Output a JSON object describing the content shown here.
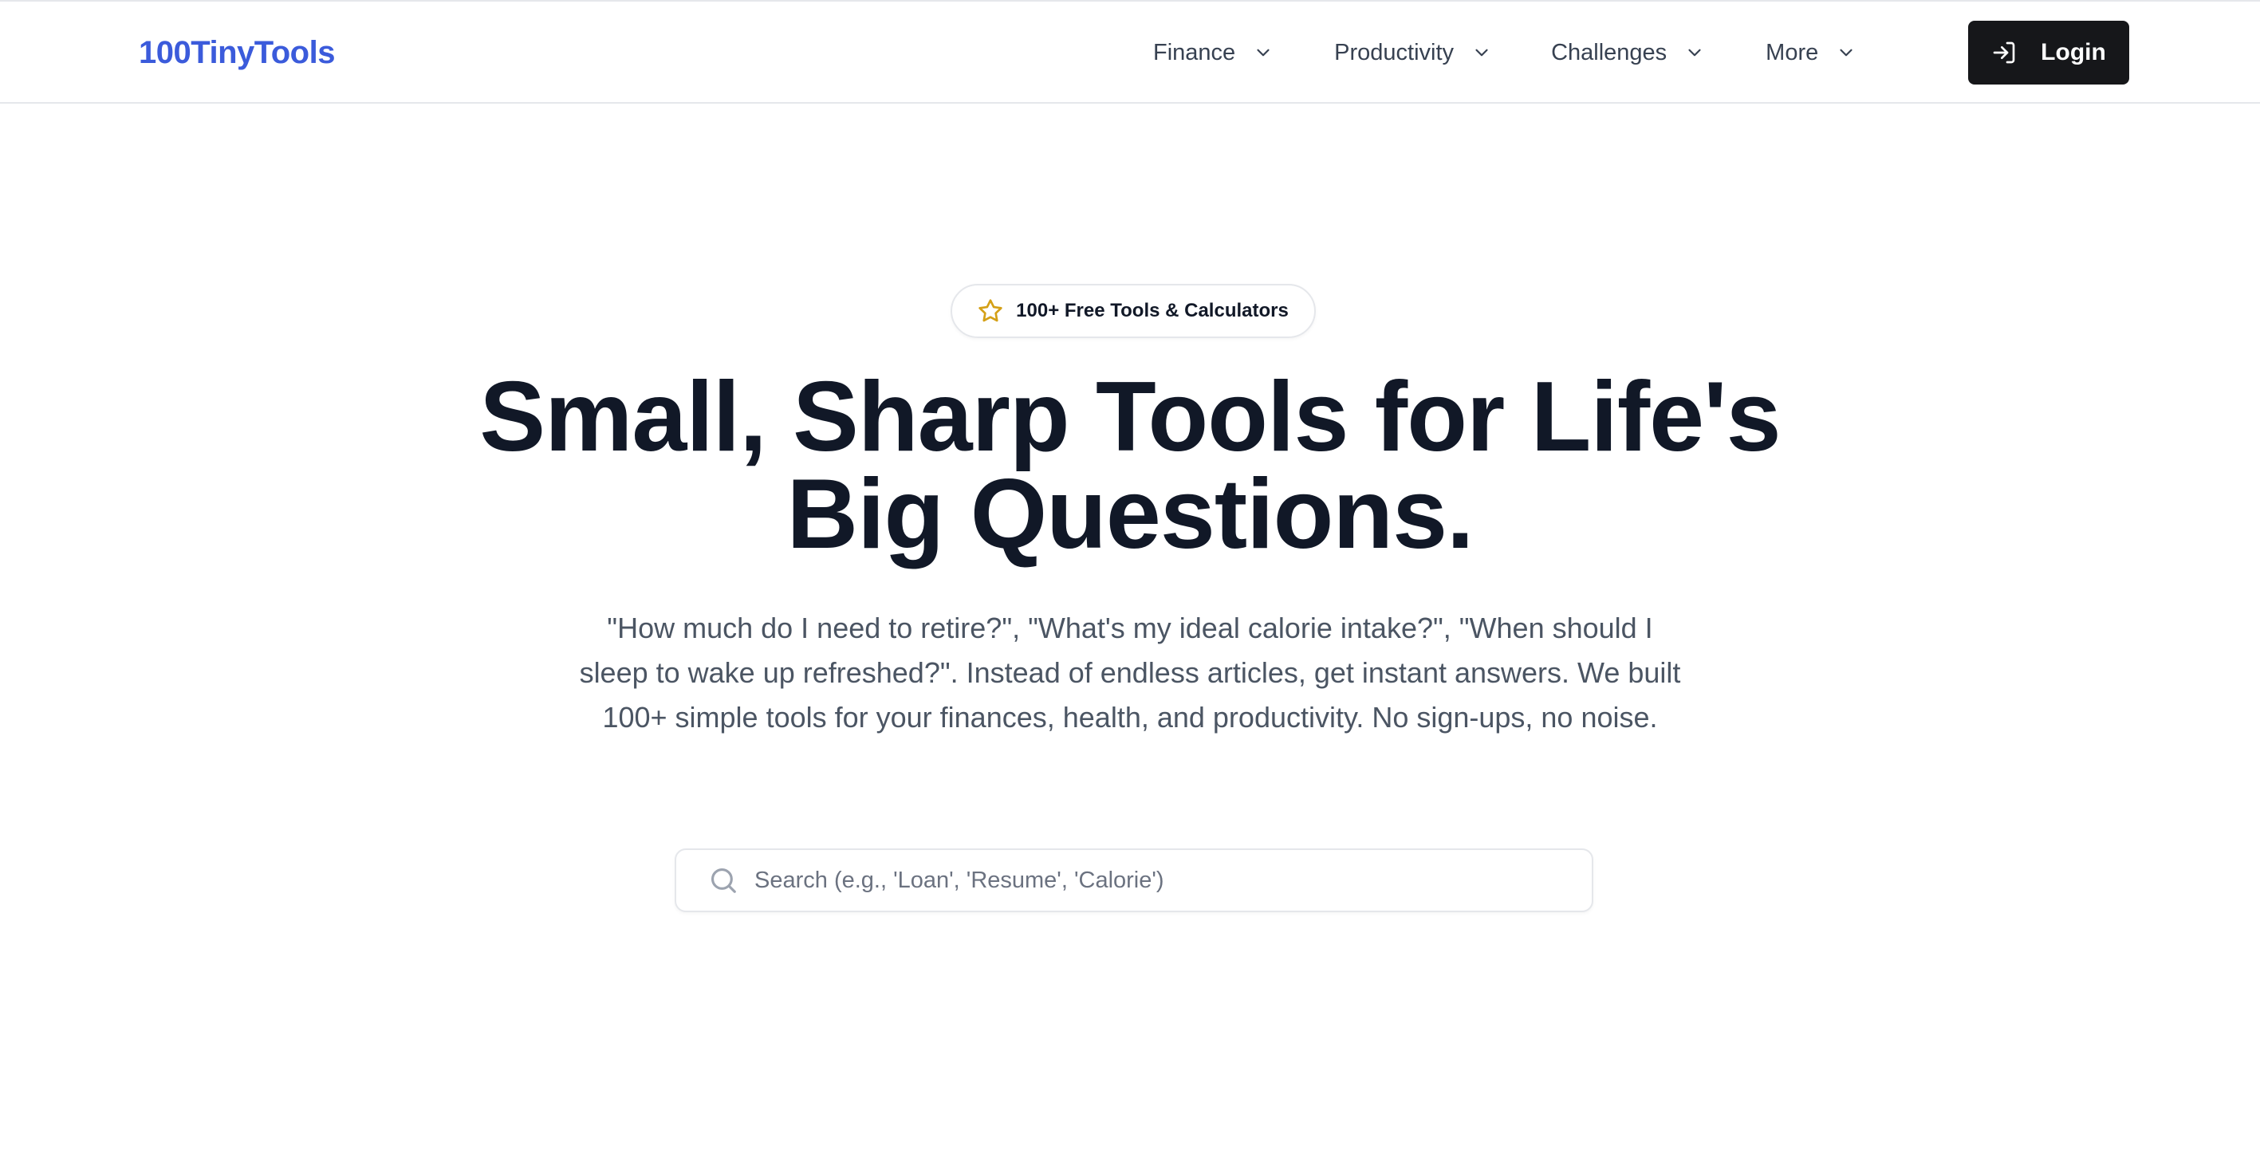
{
  "header": {
    "logo": "100TinyTools",
    "nav": [
      {
        "label": "Finance",
        "icon": "chevron-down-icon"
      },
      {
        "label": "Productivity",
        "icon": "chevron-down-icon"
      },
      {
        "label": "Challenges",
        "icon": "chevron-down-icon"
      },
      {
        "label": "More",
        "icon": "chevron-down-icon"
      }
    ],
    "login": {
      "label": "Login",
      "icon": "login-icon"
    }
  },
  "hero": {
    "badge": {
      "label": "100+ Free Tools & Calculators",
      "icon": "star-icon"
    },
    "title_line1": "Small, Sharp Tools for Life's",
    "title_line2": "Big Questions.",
    "subtitle": "\"How much do I need to retire?\", \"What's my ideal calorie intake?\", \"When should I sleep to wake up refreshed?\". Instead of endless articles, get instant answers. We built 100+ simple tools for your finances, health, and productivity. No sign-ups, no noise."
  },
  "search": {
    "placeholder": "Search (e.g., 'Loan', 'Resume', 'Calorie')",
    "value": "",
    "icon": "search-icon"
  },
  "colors": {
    "logo": "#3b5bdb",
    "heading": "#111827",
    "body_text": "#4b5563",
    "login_bg": "#16171a",
    "star": "#d4a017",
    "border": "#e5e7eb"
  }
}
